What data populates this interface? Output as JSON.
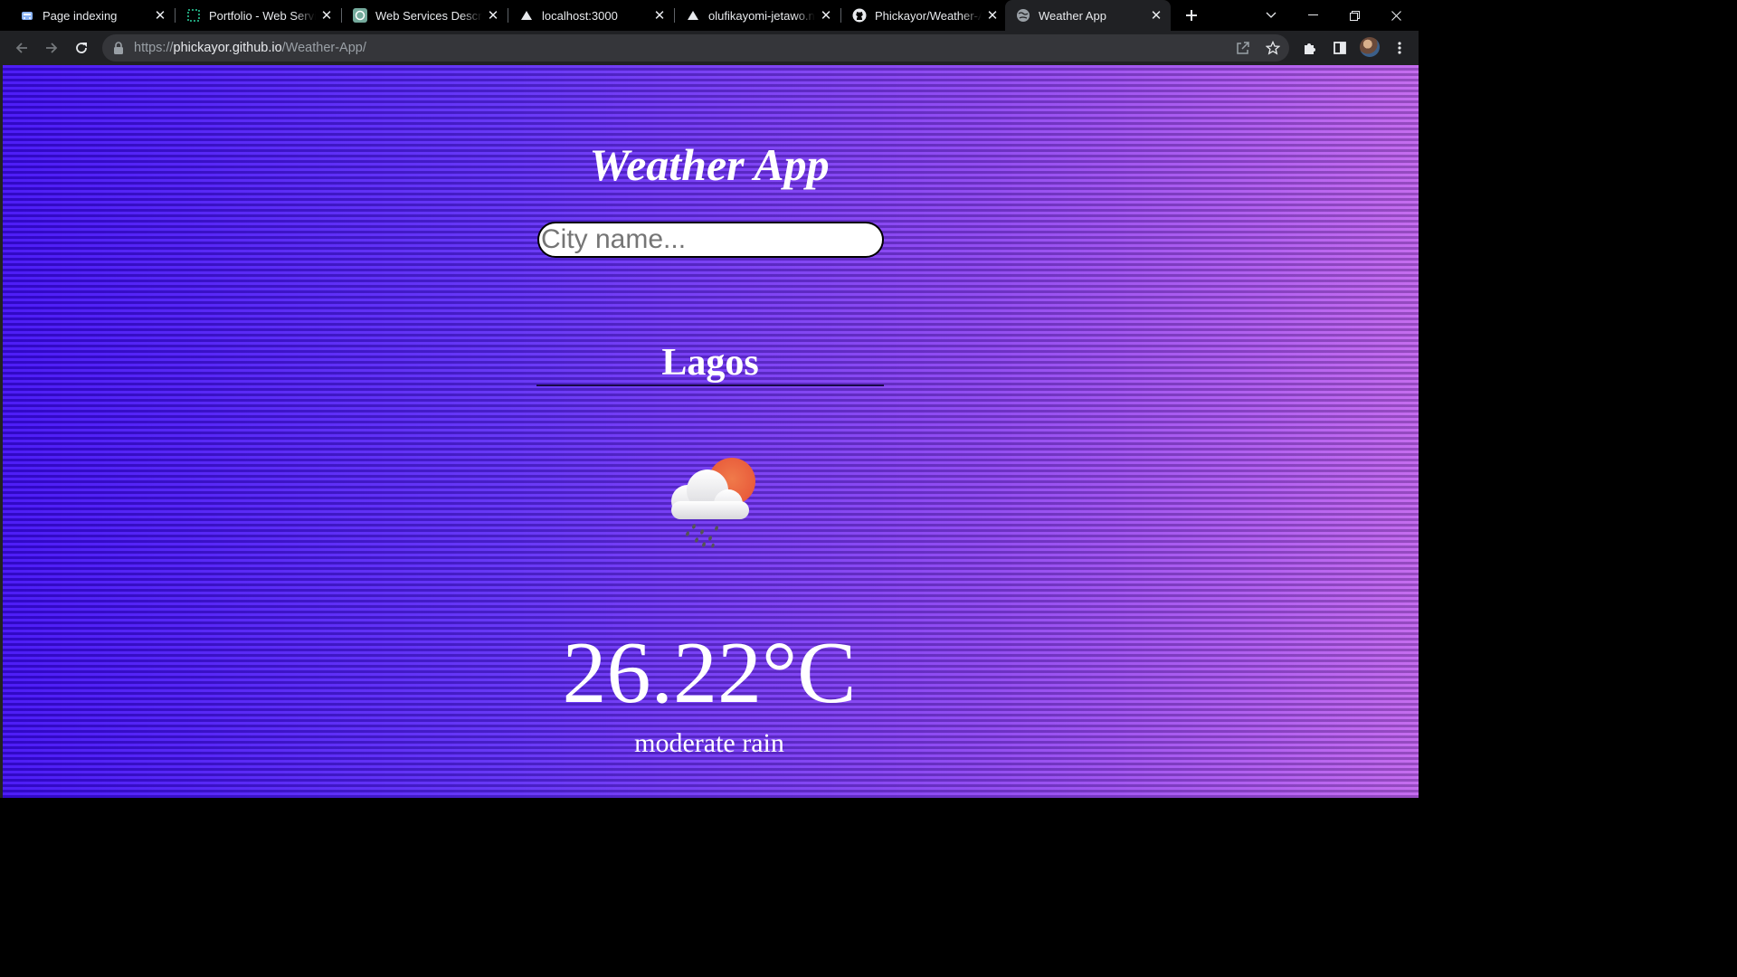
{
  "browser": {
    "tabs": [
      {
        "title": "Page indexing",
        "icon": "search-console-icon"
      },
      {
        "title": "Portfolio - Web Services",
        "icon": "dashed-square-icon"
      },
      {
        "title": "Web Services Description",
        "icon": "openai-icon"
      },
      {
        "title": "localhost:3000",
        "icon": "triangle-icon"
      },
      {
        "title": "olufikayomi-jetawo.netlify.app",
        "icon": "triangle-icon"
      },
      {
        "title": "Phickayor/Weather-App",
        "icon": "github-icon"
      },
      {
        "title": "Weather App",
        "icon": "globe-icon",
        "active": true
      }
    ],
    "url": {
      "scheme": "https://",
      "host": "phickayor.github.io",
      "path": "/Weather-App/"
    }
  },
  "page": {
    "title": "Weather App",
    "search_placeholder": "City name...",
    "city": "Lagos",
    "weather_icon": "cloud-sun-rain-icon",
    "temperature": "26.22°C",
    "description": "moderate rain",
    "colors": {
      "gradient_start": "#3e0af5",
      "gradient_end": "#c060ee",
      "text": "#ffffff"
    }
  }
}
